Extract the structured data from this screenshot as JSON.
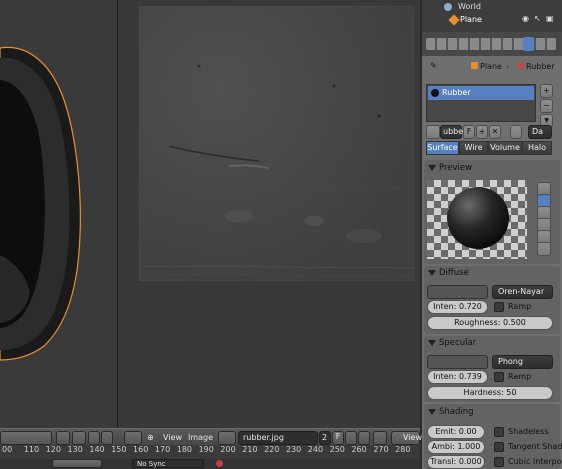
{
  "outliner": {
    "world_label": "World",
    "plane_label": "Plane"
  },
  "breadcrumb": {
    "object": "Plane",
    "material": "Rubber"
  },
  "material_list": {
    "items": [
      "Rubber"
    ]
  },
  "material_slot": {
    "name": "ubber",
    "f_label": "F",
    "data_label": "Da"
  },
  "tabs": [
    "Surface",
    "Wire",
    "Volume",
    "Halo"
  ],
  "preview": {
    "title": "Preview"
  },
  "diffuse": {
    "title": "Diffuse",
    "shader": "Oren-Nayar",
    "intensity": "Inten: 0.720",
    "ramp": "Ramp",
    "roughness": "Roughness: 0.500"
  },
  "specular": {
    "title": "Specular",
    "shader": "Phong",
    "intensity": "Inten: 0.739",
    "ramp": "Ramp",
    "hardness": "Hardness: 50"
  },
  "shading": {
    "title": "Shading",
    "emit": "Emit: 0.00",
    "shadeless": "Shadeless",
    "ambient": "Ambi: 1.000",
    "tangent": "Tangent Shadi",
    "translucency": "Transl: 0.000",
    "cubic": "Cubic Interpol"
  },
  "image_header": {
    "view_label": "View",
    "image_label": "Image",
    "image_name": "rubber.jpg",
    "users": "2",
    "f_label": "F",
    "view2_label": "View"
  },
  "timeline": {
    "ticks": [
      "00",
      "110",
      "120",
      "130",
      "140",
      "150",
      "160",
      "170",
      "180",
      "190",
      "200",
      "210",
      "220",
      "230",
      "240",
      "250",
      "260",
      "270",
      "280"
    ],
    "sync": "No Sync"
  },
  "colors": {
    "accent_selection": "#5680c2",
    "active_tab": "#5680c2",
    "object_outline": "#e8902a",
    "panel_bg": "#6f6f6f"
  }
}
